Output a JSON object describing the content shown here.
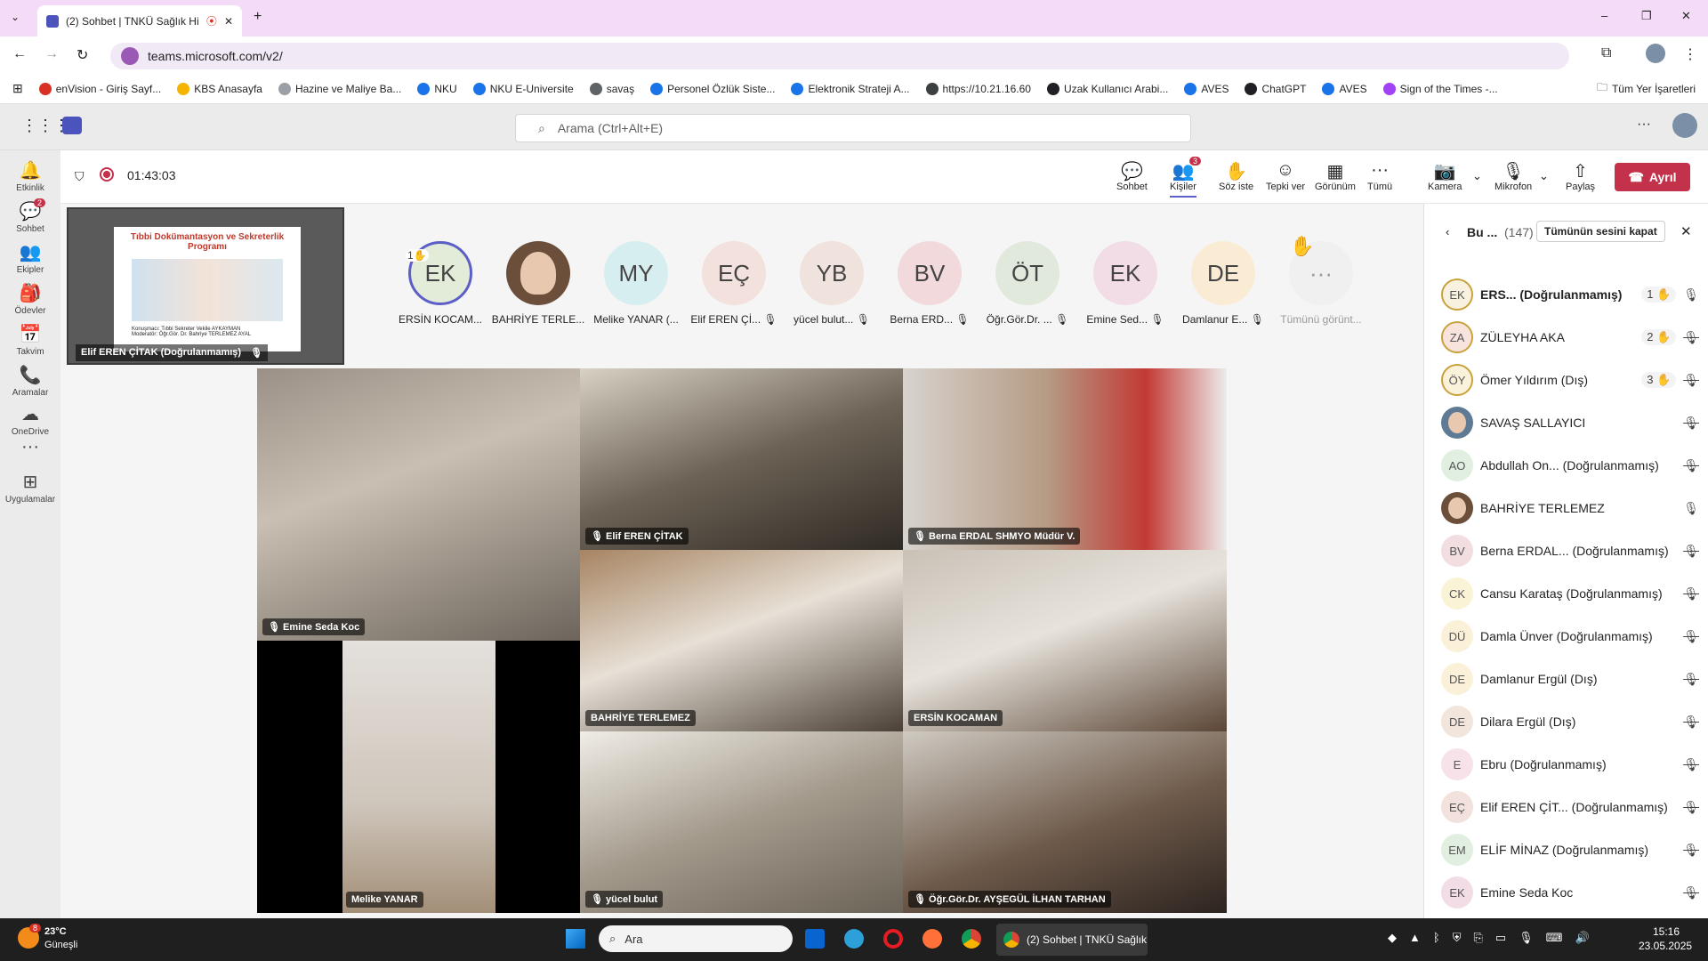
{
  "browser": {
    "tab_title": "(2) Sohbet | TNKÜ Sağlık Hi",
    "new_tab": "+",
    "url": "teams.microsoft.com/v2/",
    "window": {
      "minimize": "–",
      "maximize": "❐",
      "close": "✕"
    },
    "bookmarks": [
      {
        "label": "enVision - Giriş Sayf...",
        "color": "#d93025"
      },
      {
        "label": "KBS Anasayfa",
        "color": "#f4b400"
      },
      {
        "label": "Hazine ve Maliye Ba...",
        "color": "#9aa0a6"
      },
      {
        "label": "NKU",
        "color": "#1a73e8"
      },
      {
        "label": "NKU E-Universite",
        "color": "#1a73e8"
      },
      {
        "label": "savaş",
        "color": "#5f6368"
      },
      {
        "label": "Personel Özlük Siste...",
        "color": "#1a73e8"
      },
      {
        "label": "Elektronik Strateji A...",
        "color": "#1a73e8"
      },
      {
        "label": "https://10.21.16.60",
        "color": "#3c4043"
      },
      {
        "label": "Uzak Kullanıcı Arabi...",
        "color": "#202124"
      },
      {
        "label": "AVES",
        "color": "#1a73e8"
      },
      {
        "label": "ChatGPT",
        "color": "#202124"
      },
      {
        "label": "AVES",
        "color": "#1a73e8"
      },
      {
        "label": "Sign of the Times -...",
        "color": "#a142f4"
      }
    ],
    "all_bookmarks": "Tüm Yer İşaretleri"
  },
  "teams": {
    "search_placeholder": "Arama (Ctrl+Alt+E)",
    "more": "···",
    "rail": [
      {
        "label": "Etkinlik",
        "icon": "bell-icon",
        "glyph": "🔔"
      },
      {
        "label": "Sohbet",
        "icon": "chat-icon",
        "glyph": "💬",
        "badge": "2"
      },
      {
        "label": "Ekipler",
        "icon": "teams-icon",
        "glyph": "👥"
      },
      {
        "label": "Ödevler",
        "icon": "assignments-icon",
        "glyph": "🎒"
      },
      {
        "label": "Takvim",
        "icon": "calendar-icon",
        "glyph": "📅"
      },
      {
        "label": "Aramalar",
        "icon": "phone-icon",
        "glyph": "📞"
      },
      {
        "label": "OneDrive",
        "icon": "cloud-icon",
        "glyph": "☁"
      },
      {
        "label": "",
        "icon": "more-icon",
        "glyph": "···"
      },
      {
        "label": "Uygulamalar",
        "icon": "apps-icon",
        "glyph": "⊞"
      }
    ]
  },
  "meeting": {
    "timer": "01:43:03",
    "toolbar": [
      {
        "label": "Sohbet",
        "glyph": "💬"
      },
      {
        "label": "Kişiler",
        "glyph": "👥",
        "badge": "3"
      },
      {
        "label": "Söz iste",
        "glyph": "✋"
      },
      {
        "label": "Tepki ver",
        "glyph": "☺"
      },
      {
        "label": "Görünüm",
        "glyph": "▦"
      },
      {
        "label": "Tümü",
        "glyph": "···"
      }
    ],
    "camera": "Kamera",
    "mic": "Mikrofon",
    "share": "Paylaş",
    "leave": "Ayrıl",
    "share_tile": {
      "title": "Tıbbi Dokümantasyon ve Sekreterlik Programı",
      "sub1": "Konuşmacı: Tıbbi Sekreter Vekile AYKAYMAN",
      "sub2": "Moderatör: Öğr.Gör. Dr. Bahriye TERLEMEZ AYAL",
      "presenter": "Elif EREN ÇİTAK (Doğrulanmamış)"
    },
    "strip": [
      {
        "initials": "EK",
        "name": "ERSİN KOCAM...",
        "bg": "#e3ecd9",
        "hand": "1✋"
      },
      {
        "initials": "",
        "name": "BAHRİYE TERLE...",
        "bg": "#6b4f3a",
        "photo": true
      },
      {
        "initials": "MY",
        "name": "Melike YANAR (...",
        "bg": "#d7eef0"
      },
      {
        "initials": "EÇ",
        "name": "Elif EREN Çİ...",
        "bg": "#f2e1dc",
        "muted": true
      },
      {
        "initials": "YB",
        "name": "yücel bulut...",
        "bg": "#f0e2dc",
        "muted": true
      },
      {
        "initials": "BV",
        "name": "Berna ERD...",
        "bg": "#f1d9dc",
        "muted": true
      },
      {
        "initials": "ÖT",
        "name": "Öğr.Gör.Dr. ...",
        "bg": "#e1e9dc",
        "muted": true
      },
      {
        "initials": "EK",
        "name": "Emine Sed...",
        "bg": "#f2dce6",
        "muted": true
      },
      {
        "initials": "DE",
        "name": "Damlanur E...",
        "bg": "#faecd4",
        "muted": true
      },
      {
        "initials": "···",
        "name": "Tümünü görünt...",
        "bg": "#f0f0f0"
      }
    ],
    "raised_hand": "✋",
    "tiles": [
      {
        "name": "Emine Seda Koc",
        "muted": true
      },
      {
        "name": "Elif EREN ÇİTAK",
        "muted": true
      },
      {
        "name": "Berna ERDAL SHMYO Müdür V.",
        "muted": true
      },
      {
        "name": "BAHRİYE TERLEMEZ",
        "muted": false
      },
      {
        "name": "ERSİN KOCAMAN",
        "muted": false
      },
      {
        "name": "Melike YANAR",
        "muted": false
      },
      {
        "name": "yücel bulut",
        "muted": true
      },
      {
        "name": "Öğr.Gör.Dr. AYŞEGÜL İLHAN TARHAN",
        "muted": true
      }
    ]
  },
  "panel": {
    "back": "Bu ...",
    "count": "(147)",
    "mute_all": "Tümünün sesini kapat",
    "close": "✕",
    "people": [
      {
        "initials": "EK",
        "name": "ERS... (Doğrulanmamış)",
        "bg": "#f8f1e0",
        "hand": "1 ✋",
        "mic": "on",
        "bold": true,
        "ring": "#c8a23a"
      },
      {
        "initials": "ZA",
        "name": "ZÜLEYHA AKA",
        "bg": "#f8e4dd",
        "hand": "2 ✋",
        "mic": "off",
        "ring": "#c8a23a"
      },
      {
        "initials": "ÖY",
        "name": "Ömer Yıldırım (Dış)",
        "bg": "#fbf2dc",
        "hand": "3 ✋",
        "mic": "off",
        "ring": "#c8a23a"
      },
      {
        "initials": "",
        "name": "SAVAŞ SALLAYICI",
        "bg": "#5e7a94",
        "mic": "off",
        "photo": true
      },
      {
        "initials": "AO",
        "name": "Abdullah On... (Doğrulanmamış)",
        "bg": "#e1efe0",
        "mic": "off"
      },
      {
        "initials": "",
        "name": "BAHRİYE TERLEMEZ",
        "bg": "#6b4f3a",
        "mic": "on",
        "photo": true
      },
      {
        "initials": "BV",
        "name": "Berna ERDAL... (Doğrulanmamış)",
        "bg": "#f2dde0",
        "mic": "off"
      },
      {
        "initials": "CK",
        "name": "Cansu Karataş (Doğrulanmamış)",
        "bg": "#fbf3d6",
        "mic": "off"
      },
      {
        "initials": "DÜ",
        "name": "Damla Ünver (Doğrulanmamış)",
        "bg": "#fbf0d8",
        "mic": "off"
      },
      {
        "initials": "DE",
        "name": "Damlanur Ergül (Dış)",
        "bg": "#fbf0d8",
        "mic": "off"
      },
      {
        "initials": "DE",
        "name": "Dilara Ergül (Dış)",
        "bg": "#f2e5dc",
        "mic": "off"
      },
      {
        "initials": "E",
        "name": "Ebru (Doğrulanmamış)",
        "bg": "#f7e2ea",
        "mic": "off"
      },
      {
        "initials": "EÇ",
        "name": "Elif EREN ÇİT... (Doğrulanmamış)",
        "bg": "#f2e1dc",
        "mic": "off"
      },
      {
        "initials": "EM",
        "name": "ELİF MİNAZ (Doğrulanmamış)",
        "bg": "#e1efe0",
        "mic": "off"
      },
      {
        "initials": "EK",
        "name": "Emine Seda Koc",
        "bg": "#f2dce6",
        "mic": "off"
      }
    ]
  },
  "taskbar": {
    "temp": "23°C",
    "weather": "Güneşli",
    "weather_badge": "8",
    "search": "Ara",
    "active_app": "(2) Sohbet | TNKÜ Sağlık",
    "time": "15:16",
    "date": "23.05.2025"
  }
}
